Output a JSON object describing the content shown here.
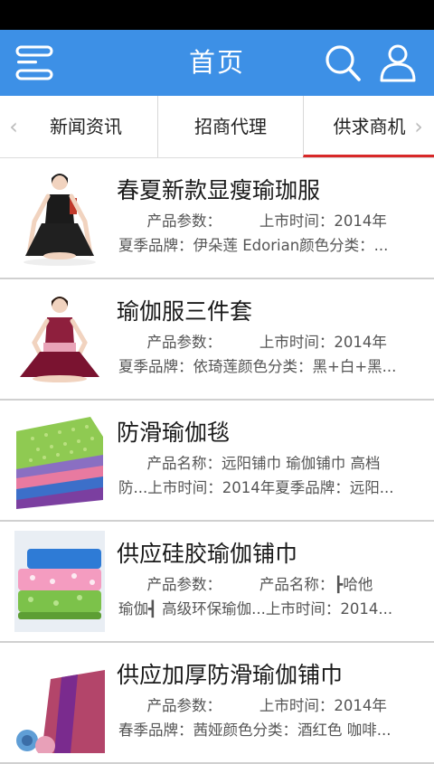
{
  "header": {
    "title": "首页",
    "menu_icon": "menu-icon",
    "search_icon": "search-icon",
    "user_icon": "user-icon"
  },
  "tabs": [
    {
      "label": "新闻资讯"
    },
    {
      "label": "招商代理"
    },
    {
      "label": "供求商机"
    }
  ],
  "colors": {
    "header": "#3d90e6",
    "tab_active_underline": "#d82828"
  },
  "items": [
    {
      "title": "春夏新款显瘦瑜珈服",
      "line1": "      产品参数：        上市时间：2014年",
      "line2": "夏季品牌：伊朵莲 Edorian颜色分类：..."
    },
    {
      "title": "瑜伽服三件套",
      "line1": "      产品参数：        上市时间：2014年",
      "line2": "夏季品牌：依琦莲颜色分类：黑+白+黑..."
    },
    {
      "title": "防滑瑜伽毯",
      "line1": "      产品名称：远阳铺巾 瑜伽铺巾 高档",
      "line2": "防...上市时间：2014年夏季品牌：远阳..."
    },
    {
      "title": "供应硅胶瑜伽铺巾",
      "line1": "      产品参数：        产品名称：┣哈他",
      "line2": "瑜伽┫ 高级环保瑜伽...上市时间：2014..."
    },
    {
      "title": "供应加厚防滑瑜伽铺巾",
      "line1": "      产品参数：        上市时间：2014年",
      "line2": "春季品牌：茜娅颜色分类：酒红色 咖啡..."
    }
  ]
}
